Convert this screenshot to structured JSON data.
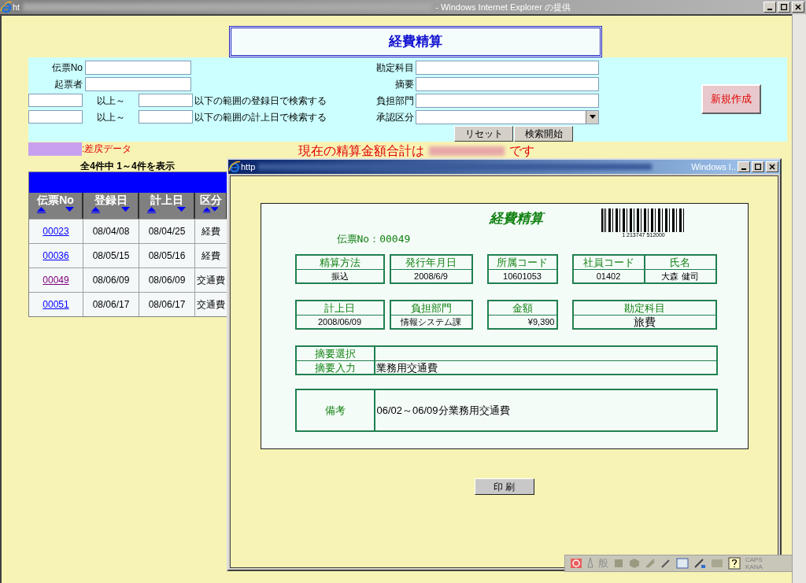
{
  "browser": {
    "title_prefix": "ht",
    "title_suffix": "- Windows Internet Explorer の提供"
  },
  "page": {
    "title": "経費精算",
    "search_left": [
      {
        "label": "伝票No"
      },
      {
        "label": "起票者"
      }
    ],
    "range_rows": [
      {
        "from_label": "以上～",
        "to_label": "以下の範囲の登録日で検索する"
      },
      {
        "from_label": "以上～",
        "to_label": "以下の範囲の計上日で検索する"
      }
    ],
    "search_right": [
      {
        "label": "勘定科目",
        "kind": "text"
      },
      {
        "label": "摘要",
        "kind": "text"
      },
      {
        "label": "負担部門",
        "kind": "text"
      },
      {
        "label": "承認区分",
        "kind": "select"
      }
    ],
    "buttons": [
      "リセット",
      "検索開始"
    ],
    "new_button": "新規作成",
    "legend": ":差戻データ",
    "total": {
      "prefix": "現在の精算金額合計は",
      "suffix": "です"
    },
    "result_count": "全4件中 1～4件を表示",
    "table": {
      "columns": [
        "伝票No",
        "登録日",
        "計上日",
        "区分"
      ],
      "rows": [
        {
          "visited": false,
          "cells": [
            "00023",
            "08/04/08",
            "08/04/25",
            "経費"
          ]
        },
        {
          "visited": false,
          "cells": [
            "00036",
            "08/05/15",
            "08/05/16",
            "経費"
          ]
        },
        {
          "visited": true,
          "cells": [
            "00049",
            "08/06/09",
            "08/06/09",
            "交通費"
          ]
        },
        {
          "visited": false,
          "cells": [
            "00051",
            "08/06/17",
            "08/06/17",
            "交通費"
          ]
        }
      ]
    }
  },
  "popup": {
    "title_prefix": "http",
    "title_suffix": "Windows I..",
    "form": {
      "title": "経費精算",
      "barcode_digits": "1 213747 512000",
      "slip_no": "伝票No：00049",
      "field_rows": [
        [
          {
            "fields": [
              {
                "label": "精算方法",
                "value": "振込",
                "kind": "plain"
              }
            ]
          },
          {
            "fields": [
              {
                "label": "発行年月日",
                "value": "2008/6/9",
                "kind": "plain"
              }
            ]
          },
          {
            "fields": [
              {
                "label": "所属コード",
                "value": "10601053",
                "kind": "plain"
              }
            ]
          },
          {
            "fields": [
              {
                "label": "社員コード",
                "value": "01402",
                "kind": "plain"
              },
              {
                "label": "氏名",
                "value": "大森 健司",
                "kind": "plain"
              }
            ]
          }
        ],
        [
          {
            "fields": [
              {
                "label": "計上日",
                "value": "2008/06/09",
                "kind": "plain"
              }
            ]
          },
          {
            "fields": [
              {
                "label": "負担部門",
                "value": "情報システム課",
                "kind": "plain"
              }
            ]
          },
          {
            "fields": [
              {
                "label": "金額",
                "value": "¥9,390",
                "kind": "amount"
              }
            ]
          },
          {
            "fields": [
              {
                "label": "勘定科目",
                "value": "旅費",
                "kind": "large"
              }
            ]
          }
        ]
      ],
      "summary": [
        {
          "label": "摘要選択"
        },
        {
          "label": "摘要入力",
          "value": "業務用交通費"
        }
      ],
      "remarks": {
        "label": "備考",
        "value": "06/02～06/09分業務用交通費"
      }
    },
    "print_button": "印 刷"
  },
  "ime_bar": {
    "mode": "般",
    "caps": "CAPS",
    "kana": "KANA"
  }
}
